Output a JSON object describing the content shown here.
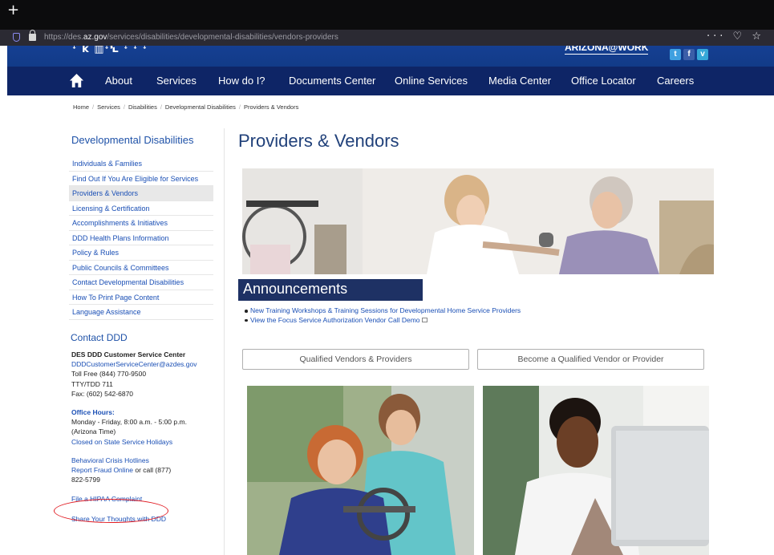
{
  "browser": {
    "new_tab": "+",
    "url_prefix": "https://des.",
    "url_domain": "az.gov",
    "url_path": "/services/disabilities/developmental-disabilities/vendors-providers",
    "toolbar_icons": "··· ♡ ☆"
  },
  "header": {
    "banner_figures": "ꜜ ꝁ ▥ꜜꝆ ꜜ ꜜ ꜜ",
    "banner_logo": "ARIZONA@WORK",
    "social": [
      "t",
      "f",
      "v"
    ],
    "nav": [
      "About",
      "Services",
      "How do I?",
      "Documents Center",
      "Online Services",
      "Media Center",
      "Office Locator",
      "Careers"
    ]
  },
  "breadcrumb": [
    "Home",
    "Services",
    "Disabilities",
    "Developmental Disabilities",
    "Providers & Vendors"
  ],
  "sidebar": {
    "title": "Developmental Disabilities",
    "items": [
      "Individuals & Families",
      "Find Out If You Are Eligible for Services",
      "Providers & Vendors",
      "Licensing & Certification",
      "Accomplishments & Initiatives",
      "DDD Health Plans Information",
      "Policy & Rules",
      "Public Councils & Committees",
      "Contact Developmental Disabilities",
      "How To Print Page Content",
      "Language Assistance"
    ],
    "active_index": 2,
    "contact_title": "Contact DDD",
    "center_name": "DES DDD Customer Service Center",
    "email": "DDDCustomerServiceCenter@azdes.gov",
    "toll_free": "Toll Free (844) 770-9500",
    "tty": "TTY/TDD 711",
    "fax": "Fax: (602) 542-6870",
    "office_hours_label": "Office Hours:",
    "hours_line1": "Monday - Friday, 8:00 a.m. - 5:00 p.m.",
    "hours_line2": "(Arizona Time)",
    "holidays_link": "Closed on State Service Holidays",
    "crisis_link": "Behavioral Crisis Hotlines",
    "fraud_link": "Report Fraud Online",
    "fraud_suffix": " or call (877)",
    "fraud_phone": "822-5799",
    "hipaa_link": "File a HIPAA Complaint",
    "thoughts_link": "Share Your Thoughts with DDD"
  },
  "main": {
    "title": "Providers & Vendors",
    "announcements_heading": "Announcements",
    "announcements": [
      "New Training Workshops & Training Sessions for Developmental Home Service Providers",
      "View the Focus Service Authorization Vendor Call Demo"
    ],
    "button_left": "Qualified Vendors & Providers",
    "button_right": "Become a Qualified Vendor or Provider"
  }
}
